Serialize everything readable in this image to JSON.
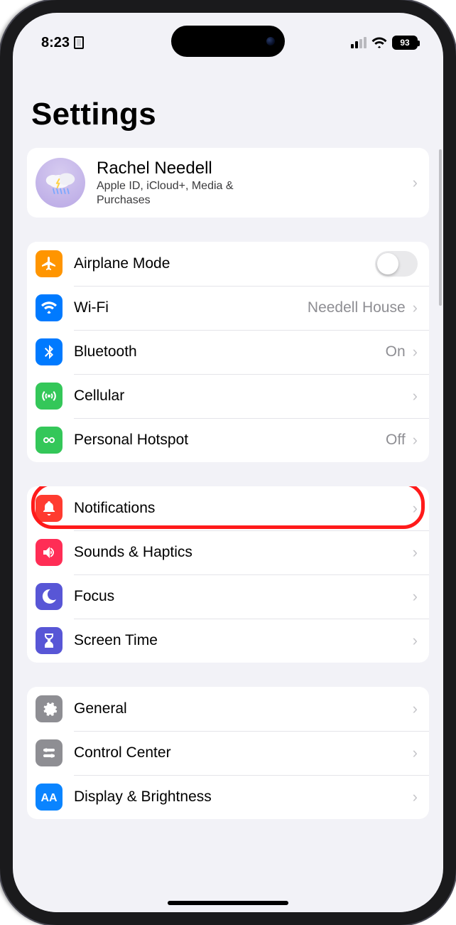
{
  "status": {
    "time": "8:23",
    "battery": "93"
  },
  "title": "Settings",
  "profile": {
    "name": "Rachel Needell",
    "subtitle": "Apple ID, iCloud+, Media & Purchases"
  },
  "groups": [
    {
      "rows": [
        {
          "id": "airplane",
          "label": "Airplane Mode",
          "value": "",
          "toggle": true
        },
        {
          "id": "wifi",
          "label": "Wi-Fi",
          "value": "Needell House"
        },
        {
          "id": "bluetooth",
          "label": "Bluetooth",
          "value": "On"
        },
        {
          "id": "cellular",
          "label": "Cellular",
          "value": ""
        },
        {
          "id": "hotspot",
          "label": "Personal Hotspot",
          "value": "Off"
        }
      ]
    },
    {
      "rows": [
        {
          "id": "notifications",
          "label": "Notifications",
          "value": "",
          "highlighted": true
        },
        {
          "id": "sounds",
          "label": "Sounds & Haptics",
          "value": ""
        },
        {
          "id": "focus",
          "label": "Focus",
          "value": ""
        },
        {
          "id": "screentime",
          "label": "Screen Time",
          "value": ""
        }
      ]
    },
    {
      "rows": [
        {
          "id": "general",
          "label": "General",
          "value": ""
        },
        {
          "id": "control",
          "label": "Control Center",
          "value": ""
        },
        {
          "id": "display",
          "label": "Display & Brightness",
          "value": ""
        }
      ]
    }
  ]
}
